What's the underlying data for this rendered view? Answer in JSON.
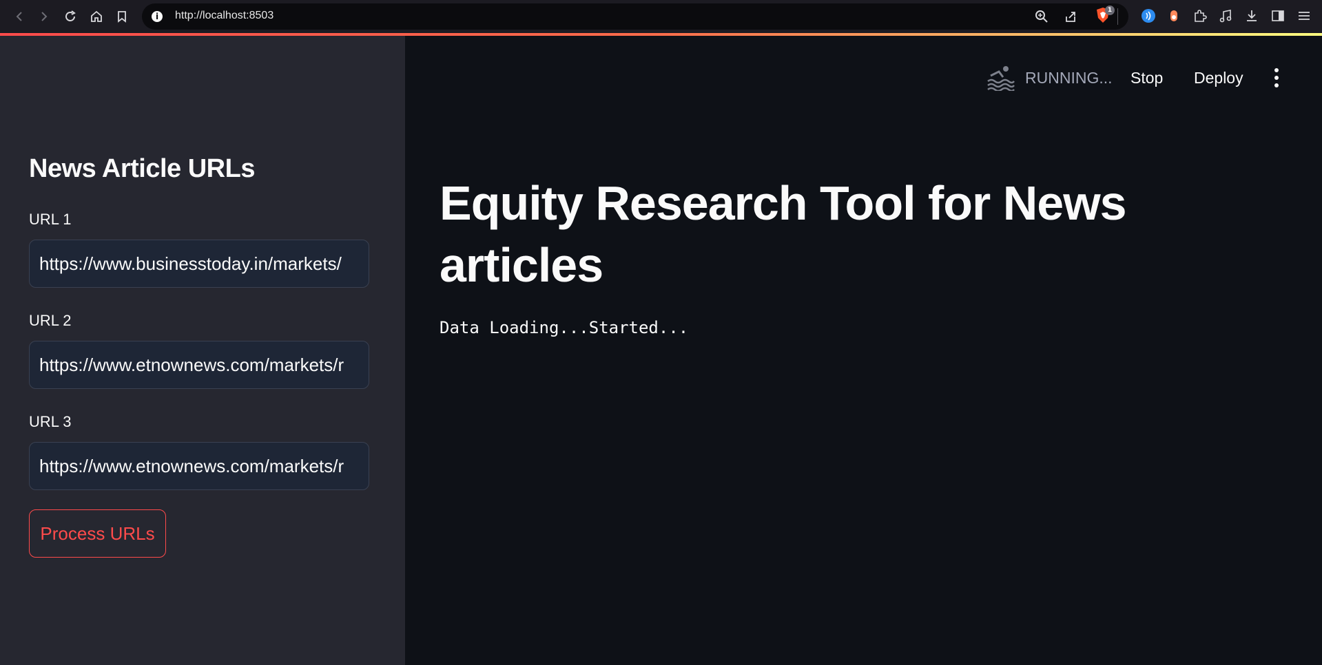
{
  "browser": {
    "url": "http://localhost:8503",
    "shield_badge": "1"
  },
  "sidebar": {
    "title": "News Article URLs",
    "fields": [
      {
        "label": "URL 1",
        "value": "https://www.businesstoday.in/markets/"
      },
      {
        "label": "URL 2",
        "value": "https://www.etnownews.com/markets/r"
      },
      {
        "label": "URL 3",
        "value": "https://www.etnownews.com/markets/r"
      }
    ],
    "process_button": "Process URLs"
  },
  "header": {
    "status": "RUNNING...",
    "stop": "Stop",
    "deploy": "Deploy"
  },
  "main": {
    "title": "Equity Research Tool for News articles",
    "status_message": "Data Loading...Started..."
  },
  "colors": {
    "accent": "#ff4b4b",
    "sidebar_bg": "#262730",
    "main_bg": "#0e1117"
  }
}
